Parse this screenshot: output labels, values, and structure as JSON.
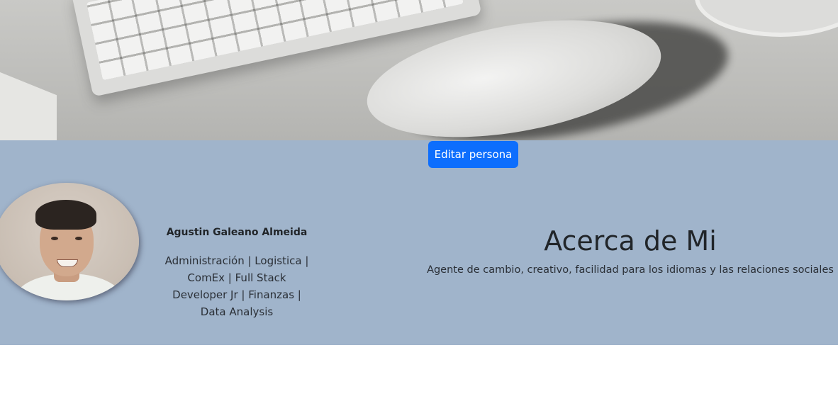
{
  "banner": {
    "alt": "Keyboard and mouse on desk"
  },
  "profile": {
    "edit_button_label": "Editar persona",
    "name": "Agustin Galeano Almeida",
    "title": "Administración | Logistica | ComEx | Full Stack Developer Jr | Finanzas | Data Analysis"
  },
  "about": {
    "heading": "Acerca de Mi",
    "description": "Agente de cambio, creativo, facilidad para los idiomas y las relaciones sociales"
  },
  "colors": {
    "profile_background": "#a0b4cb",
    "button_primary": "#0d6efd",
    "text": "#212529"
  }
}
